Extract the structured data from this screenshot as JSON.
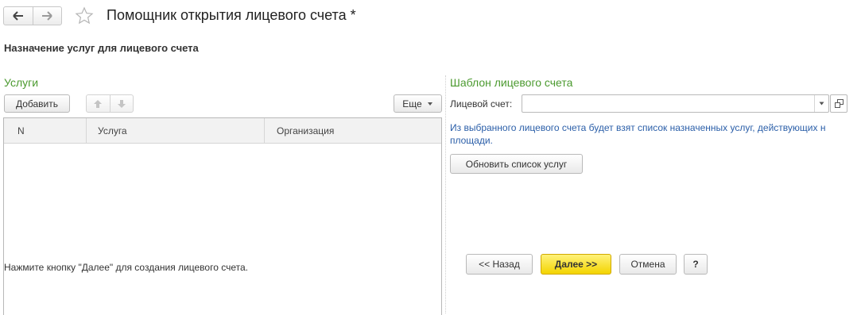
{
  "window": {
    "title": "Помощник открытия лицевого счета *"
  },
  "section_title": "Назначение услуг для лицевого счета",
  "services": {
    "group_title": "Услуги",
    "add_label": "Добавить",
    "more_label": "Еще",
    "columns": [
      "N",
      "Услуга",
      "Организация"
    ],
    "rows": []
  },
  "template": {
    "group_title": "Шаблон лицевого счета",
    "account_label": "Лицевой счет:",
    "account_value": "",
    "info_text": "Из выбранного лицевого счета будет взят список назначенных услуг, действующих н площади.",
    "refresh_label": "Обновить список услуг"
  },
  "footer": {
    "note": "Нажмите кнопку \"Далее\" для создания лицевого счета.",
    "back_label": "<< Назад",
    "next_label": "Далее >>",
    "cancel_label": "Отмена",
    "help_label": "?"
  },
  "colors": {
    "group_title": "#4b9a2f",
    "info_text": "#2a5ea8",
    "primary_button": "#f3d400"
  }
}
